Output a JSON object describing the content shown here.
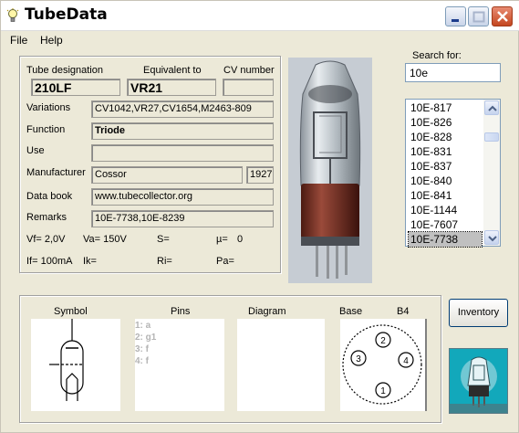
{
  "window": {
    "title": "TubeData"
  },
  "menu": {
    "items": [
      "File",
      "Help"
    ]
  },
  "fields": {
    "tube_designation": {
      "label": "Tube designation",
      "value": "210LF"
    },
    "equivalent": {
      "label": "Equivalent to",
      "value": "VR21"
    },
    "cv_number": {
      "label": "CV number",
      "value": ""
    },
    "variations": {
      "label": "Variations",
      "value": "CV1042,VR27,CV1654,M2463-809"
    },
    "function": {
      "label": "Function",
      "value": "Triode"
    },
    "use": {
      "label": "Use",
      "value": ""
    },
    "manufacturer": {
      "label": "Manufacturer",
      "value": "Cossor",
      "year": "1927"
    },
    "data_book": {
      "label": "Data book",
      "value": "www.tubecollector.org"
    },
    "remarks": {
      "label": "Remarks",
      "value": "10E-7738,10E-8239"
    }
  },
  "params": {
    "vf": "Vf= 2,0V",
    "va": "Va= 150V",
    "s": "S=",
    "mu": "µ=",
    "mu_value": "0",
    "if": "If= 100mA",
    "ik": "Ik=",
    "ri": "Ri=",
    "pa": "Pa="
  },
  "search": {
    "label": "Search for:",
    "value": "10e",
    "results": [
      "10E-817",
      "10E-826",
      "10E-828",
      "10E-831",
      "10E-837",
      "10E-840",
      "10E-841",
      "10E-1144",
      "10E-7607",
      "10E-7738"
    ],
    "selected_index": 9
  },
  "bottom": {
    "symbol_label": "Symbol",
    "pins_label": "Pins",
    "diagram_label": "Diagram",
    "base_label": "Base",
    "base_type": "B4",
    "pins": [
      "1: a",
      "2: g1",
      "3: f",
      "4: f"
    ],
    "base_pin_numbers": [
      "1",
      "2",
      "3",
      "4"
    ]
  },
  "buttons": {
    "inventory": "Inventory"
  }
}
